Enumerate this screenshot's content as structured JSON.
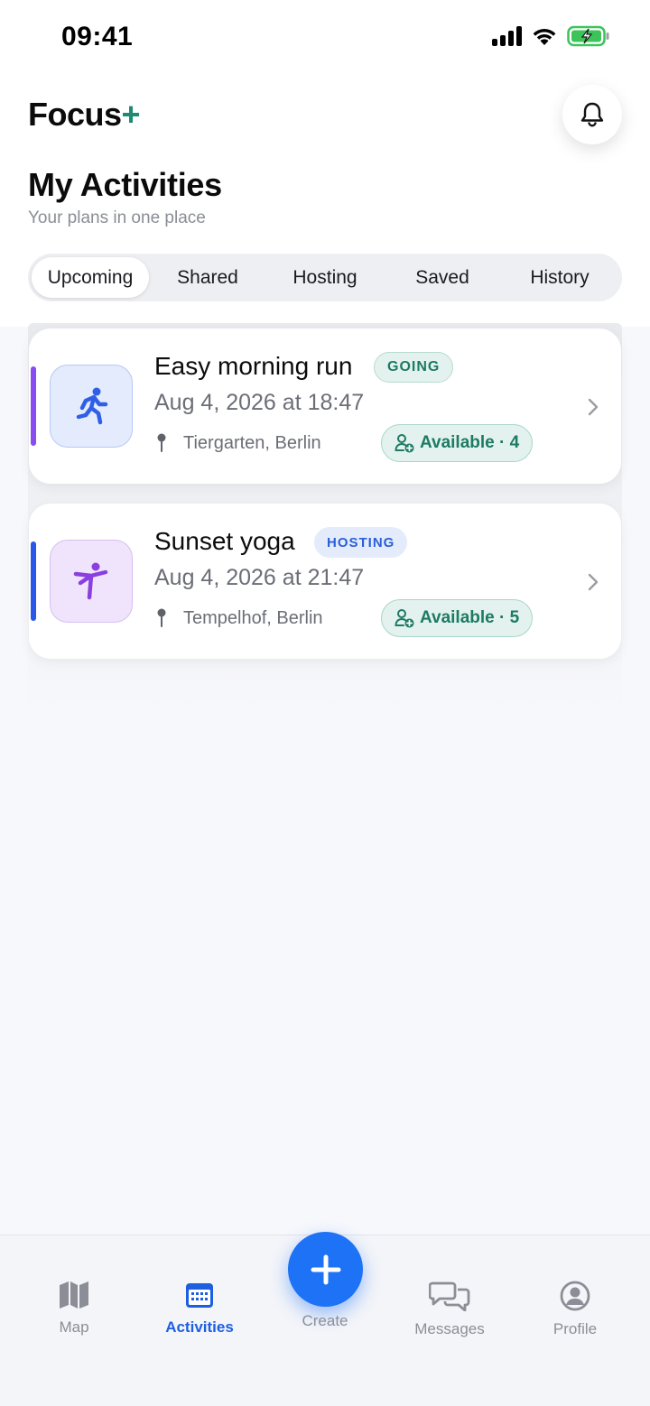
{
  "status_bar": {
    "time": "09:41"
  },
  "header": {
    "logo_text": "Focus",
    "logo_plus": "+"
  },
  "page": {
    "title": "My Activities",
    "subtitle": "Your plans in one place"
  },
  "tabs": [
    {
      "label": "Upcoming",
      "active": true
    },
    {
      "label": "Shared"
    },
    {
      "label": "Hosting"
    },
    {
      "label": "Saved"
    },
    {
      "label": "History"
    }
  ],
  "activities": [
    {
      "title": "Easy morning run",
      "badge": "GOING",
      "datetime": "Aug 4, 2026 at 18:47",
      "location": "Tiergarten, Berlin",
      "availability": "Available · 4",
      "icon": "running-icon",
      "accent_color": "#8a4cf0",
      "badge_bg": "#e3f2ee",
      "badge_color": "#1d7a63"
    },
    {
      "title": "Sunset yoga",
      "badge": "HOSTING",
      "datetime": "Aug 4, 2026 at 21:47",
      "location": "Tempelhof, Berlin",
      "availability": "Available · 5",
      "icon": "yoga-icon",
      "accent_color": "#2a57e8",
      "badge_bg": "#e4ecfc",
      "badge_color": "#2a5fd8"
    }
  ],
  "bottom_nav": {
    "map": "Map",
    "activities": "Activities",
    "create": "Create",
    "messages": "Messages",
    "profile": "Profile"
  },
  "colors": {
    "accent_blue": "#1d72f5",
    "brand_green": "#1d8a72"
  }
}
